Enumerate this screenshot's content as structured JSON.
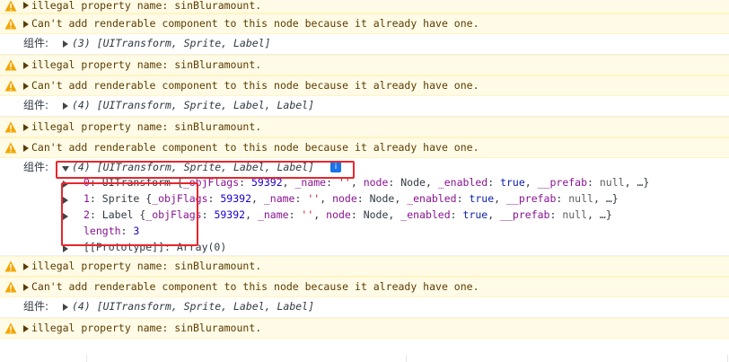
{
  "colors": {
    "warning_bg": "#fffbe6",
    "warning_text": "#5c3c00",
    "warning_icon": "#f2a600",
    "highlight": "#e8262c",
    "key": "#881391",
    "number": "#1c00cf",
    "string": "#c41a16",
    "info_badge": "#1a73e8"
  },
  "icons": {
    "warning": "warning-triangle-icon",
    "expand": "chevron-right-icon",
    "collapse": "chevron-down-icon",
    "info": "info-icon"
  },
  "messages": {
    "illegal": "illegal property name: sinBluramount.",
    "cant_add": "Can't add renderable component to this node because it already have one."
  },
  "log_label": "组件:",
  "logs": {
    "log1": "(3) [UITransform, Sprite, Label]",
    "log2": "(4) [UITransform, Sprite, Label, Label]",
    "log3": "(4) [UITransform, Sprite, Label, Label]",
    "log4": "(4) [UITransform, Sprite, Label, Label]"
  },
  "info_badge": "i",
  "expanded": {
    "items": [
      {
        "index": "0",
        "name": "UITransform",
        "objflags": "59392",
        "name_val": "''",
        "node": "Node",
        "enabled": "true",
        "prefab": "null"
      },
      {
        "index": "1",
        "name": "Sprite",
        "objflags": "59392",
        "name_val": "''",
        "node": "Node",
        "enabled": "true",
        "prefab": "null"
      },
      {
        "index": "2",
        "name": "Label",
        "objflags": "59392",
        "name_val": "''",
        "node": "Node",
        "enabled": "true",
        "prefab": "null"
      }
    ],
    "length_key": "length",
    "length_val": "3",
    "prototype_key": "[[Prototype]]",
    "prototype_val": "Array(0)"
  },
  "tokens": {
    "objflags_key": "_objFlags",
    "name_key": "_name",
    "node_key": "node",
    "enabled_key": "_enabled",
    "prefab_key": "__prefab",
    "ellipsis": "…"
  }
}
